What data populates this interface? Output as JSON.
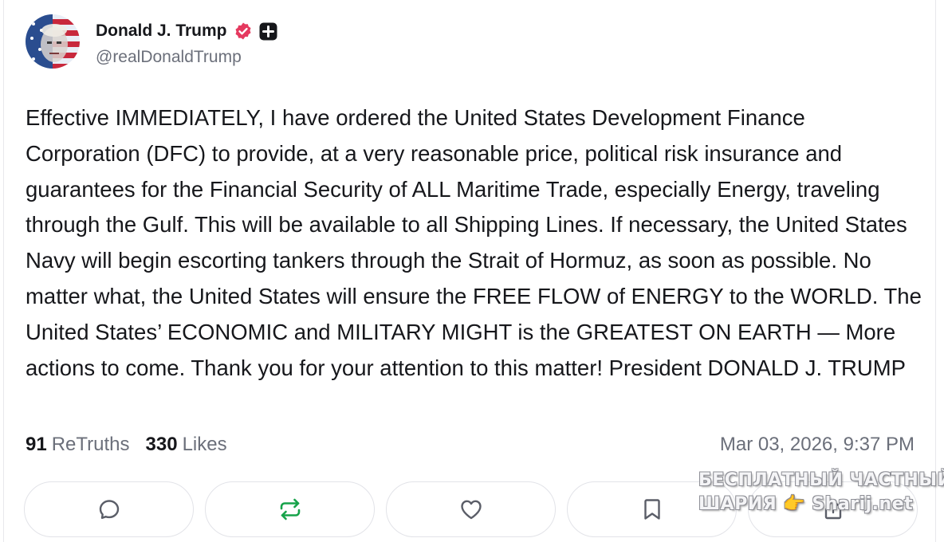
{
  "author": {
    "display_name": "Donald J. Trump",
    "handle": "@realDonaldTrump",
    "avatar_icon": "avatar-flag-portrait",
    "verified_icon": "verified-badge-icon",
    "plus_icon": "plus-badge-icon"
  },
  "post": {
    "text": "Effective IMMEDIATELY, I have ordered the United States Development Finance Corporation (DFC) to provide, at a very reasonable price, political risk insurance and guarantees for the Financial Security of ALL Maritime Trade, especially Energy, traveling through the Gulf. This will be available to all Shipping Lines. If necessary, the United States Navy will begin escorting tankers through the Strait of Hormuz, as soon as possible. No matter what, the United States will ensure the FREE FLOW of ENERGY to the WORLD. The United States’ ECONOMIC and MILITARY MIGHT is the GREATEST ON EARTH — More actions to come. Thank you for your attention to this matter! President DONALD J. TRUMP"
  },
  "stats": {
    "retruths_count": "91",
    "retruths_label": "ReTruths",
    "likes_count": "330",
    "likes_label": "Likes",
    "timestamp": "Mar 03, 2026, 9:37 PM"
  },
  "actions": [
    {
      "icon": "reply-icon"
    },
    {
      "icon": "retruth-icon"
    },
    {
      "icon": "like-icon"
    },
    {
      "icon": "bookmark-icon"
    },
    {
      "icon": "share-icon"
    }
  ],
  "watermark": {
    "line1": "БЕСПЛАТНЫЙ ЧАСТНЫЙ",
    "line2": "ШАРИЯ 👉 Sharij.net"
  },
  "colors": {
    "verified": "#e5395f",
    "retruth_green": "#17a34a",
    "icon_grey": "#5b5e68",
    "text_secondary": "#6b6f7a"
  }
}
